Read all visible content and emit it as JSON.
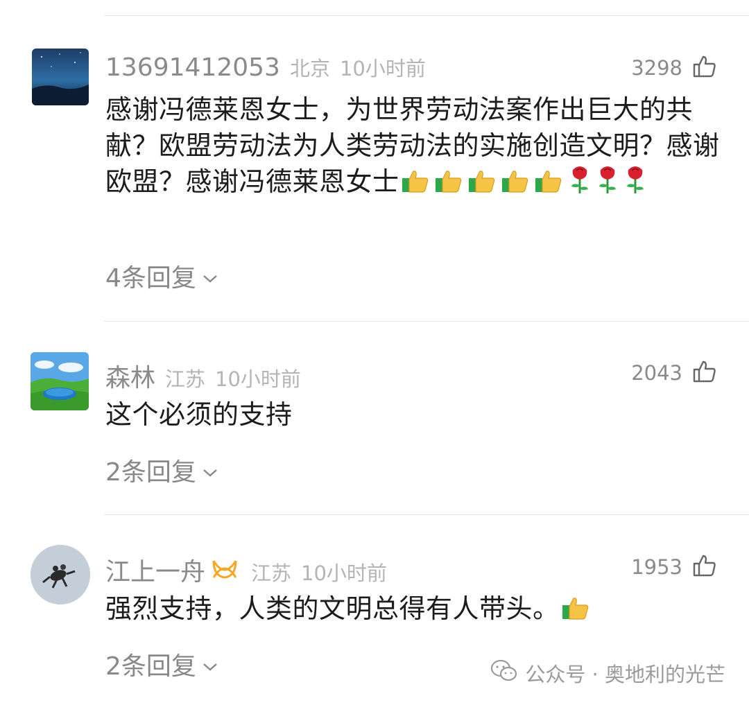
{
  "comments": [
    {
      "name": "13691412053",
      "location": "北京",
      "time": "10小时前",
      "likes": "3298",
      "text_a": "感谢冯德莱恩女士，为世界劳动法案作出巨大的共献？欧盟劳动法为人类劳动法的实施创造文明？感谢欧盟？感谢冯德莱恩女士",
      "emojis": [
        "thumbs-up-icon",
        "thumbs-up-icon",
        "thumbs-up-icon",
        "thumbs-up-icon",
        "thumbs-up-icon",
        "rose-icon",
        "rose-icon",
        "rose-icon"
      ],
      "replies": "4条回复"
    },
    {
      "name": "森林",
      "location": "江苏",
      "time": "10小时前",
      "likes": "2043",
      "text_a": "这个必须的支持",
      "replies": "2条回复"
    },
    {
      "name": "江上一舟",
      "location": "江苏",
      "time": "10小时前",
      "likes": "1953",
      "text_a": "强烈支持，人类的文明总得有人带头。",
      "replies": "2条回复"
    }
  ],
  "watermark": {
    "text": "公众号 · 奥地利的光芒"
  },
  "colors": {
    "meta_gray": "#8a8a8a",
    "light_gray": "#b4b4b4",
    "text": "#1c1c1c",
    "badge_orange": "#f5a623"
  }
}
